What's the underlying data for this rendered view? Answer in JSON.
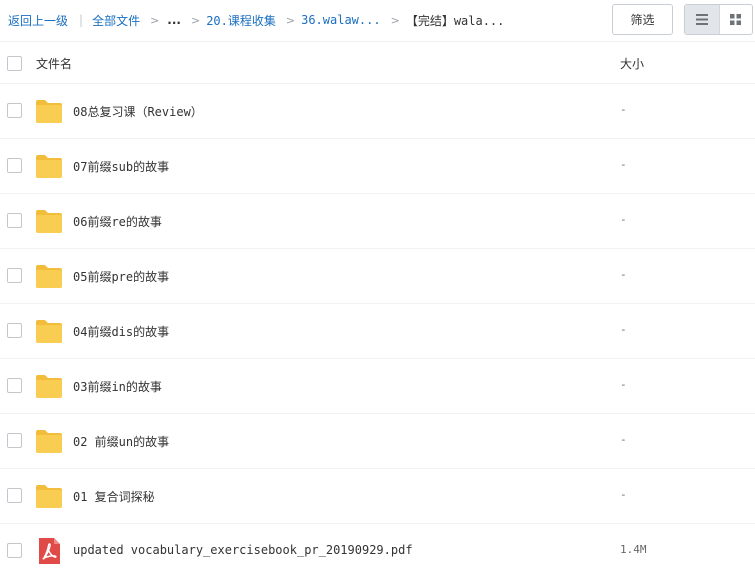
{
  "breadcrumb": {
    "back_label": "返回上一级",
    "separator": "|",
    "all_files_label": "全部文件",
    "ellipsis": "...",
    "items": [
      "20.课程收集",
      "36.walaw..."
    ],
    "current": "【完结】wala..."
  },
  "toolbar": {
    "filter_label": "筛选",
    "view_modes": [
      "list",
      "grid"
    ],
    "active_view": "list"
  },
  "table": {
    "header_name": "文件名",
    "header_size": "大小",
    "rows": [
      {
        "type": "folder",
        "name": "08总复习课（Review）",
        "size": "-"
      },
      {
        "type": "folder",
        "name": "07前缀sub的故事",
        "size": "-"
      },
      {
        "type": "folder",
        "name": "06前缀re的故事",
        "size": "-"
      },
      {
        "type": "folder",
        "name": "05前缀pre的故事",
        "size": "-"
      },
      {
        "type": "folder",
        "name": "04前缀dis的故事",
        "size": "-"
      },
      {
        "type": "folder",
        "name": "03前缀in的故事",
        "size": "-"
      },
      {
        "type": "folder",
        "name": "02 前缀un的故事",
        "size": "-"
      },
      {
        "type": "folder",
        "name": "01 复合词探秘",
        "size": "-"
      },
      {
        "type": "pdf",
        "name": "updated vocabulary_exercisebook_pr_20190929.pdf",
        "size": "1.4M"
      }
    ]
  },
  "colors": {
    "link": "#1a6fc0",
    "folder": "#f9cc52",
    "pdf": "#e04b48"
  },
  "icons": {
    "folder": "folder-icon",
    "pdf": "pdf-file-icon",
    "list_view": "list-view-icon",
    "grid_view": "grid-view-icon"
  }
}
